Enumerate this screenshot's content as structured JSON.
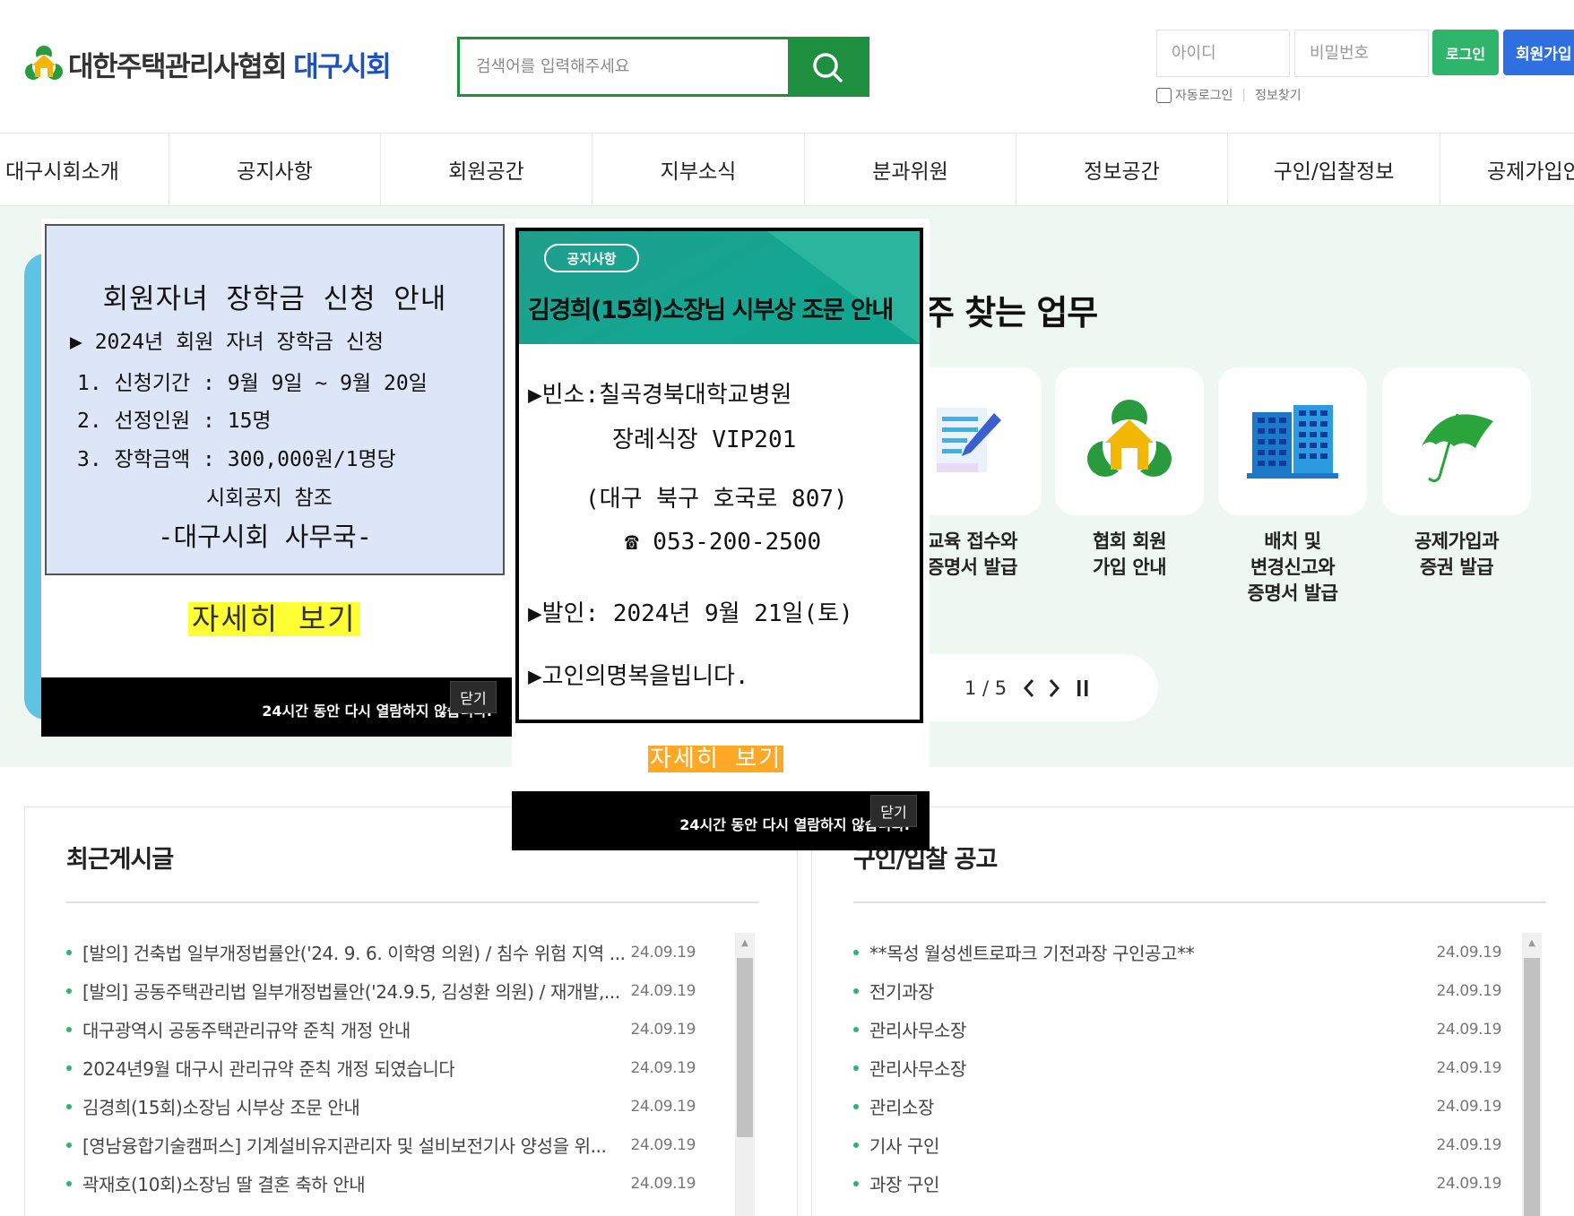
{
  "header": {
    "logo_text": "대한주택관리사협회",
    "logo_sub": "대구시회",
    "search_placeholder": "검색어를 입력해주세요",
    "id_placeholder": "아이디",
    "pw_placeholder": "비밀번호",
    "login_label": "로그인",
    "join_label": "회원가입",
    "auto_login_label": "자동로그인",
    "find_info_label": "정보찾기"
  },
  "nav": {
    "items": [
      {
        "label": "대구시회소개"
      },
      {
        "label": "공지사항"
      },
      {
        "label": "회원공간"
      },
      {
        "label": "지부소식"
      },
      {
        "label": "분과위원"
      },
      {
        "label": "정보공간"
      },
      {
        "label": "구인/입찰정보"
      },
      {
        "label": "공제가입안"
      }
    ]
  },
  "hero": {
    "title": "자주 찾는 업무",
    "title_visible": "주 찾는 업무",
    "cards": [
      {
        "icon": "document-pen-icon",
        "label_l1": "교육 접수와",
        "label_l2": "증명서 발급",
        "label_l3": ""
      },
      {
        "icon": "association-logo-icon",
        "label_l1": "협회 회원",
        "label_l2": "가입 안내",
        "label_l3": ""
      },
      {
        "icon": "building-icon",
        "label_l1": "배치 및",
        "label_l2": "변경신고와",
        "label_l3": "증명서 발급"
      },
      {
        "icon": "umbrella-icon",
        "label_l1": "공제가입과",
        "label_l2": "증권 발급",
        "label_l3": ""
      }
    ],
    "cards_visible": [
      {
        "label_l1": "교육 접수와",
        "label_l2": "증명서 발급"
      }
    ],
    "pager": "1 / 5"
  },
  "popup1": {
    "title": "회원자녀 장학금 신청 안내",
    "line1": "▶ 2024년 회원 자녀 장학금 신청",
    "line2": "1. 신청기간 : 9월 9일 ~ 9월 20일",
    "line3": "2. 선정인원 : 15명",
    "line4": "3. 장학금액 : 300,000원/1명당",
    "line5": "시회공지 참조",
    "line6": "-대구시회 사무국-",
    "more": "자세히 보기",
    "hide_msg": "24시간 동안 다시 열람하지 않습니다.",
    "close": "닫기"
  },
  "popup2": {
    "badge": "공지사항",
    "title": "김경희(15회)소장님 시부상 조문 안내",
    "line1": "▶빈소:칠곡경북대학교병원",
    "line2": "장례식장 VIP201",
    "line3": "(대구 북구 호국로 807)",
    "line4": "☎ 053-200-2500",
    "line5": "▶발인: 2024년 9월 21일(토)",
    "line6": "▶고인의명복을빕니다.",
    "more": "자세히 보기",
    "hide_msg": "24시간 동안 다시 열람하지 않습니다.",
    "close": "닫기"
  },
  "recent": {
    "title": "최근게시글",
    "items": [
      {
        "title": "[발의] 건축법 일부개정법률안('24. 9. 6. 이학영 의원) / 침수 위험 지역 ...",
        "date": "24.09.19"
      },
      {
        "title": "[발의] 공동주택관리법 일부개정법률안('24.9.5, 김성환 의원) / 재개발,...",
        "date": "24.09.19"
      },
      {
        "title": "대구광역시 공동주택관리규약 준칙 개정 안내",
        "date": "24.09.19"
      },
      {
        "title": "2024년9월 대구시 관리규약 준칙 개정 되였습니다",
        "date": "24.09.19"
      },
      {
        "title": "김경희(15회)소장님 시부상 조문 안내",
        "date": "24.09.19"
      },
      {
        "title": "[영남융합기술캠퍼스] 기계설비유지관리자 및 설비보전기사 양성을 위...",
        "date": "24.09.19"
      },
      {
        "title": "곽재호(10회)소장님 딸 결혼 축하 안내",
        "date": "24.09.19"
      }
    ]
  },
  "jobs": {
    "title": "구인/입찰 공고",
    "items": [
      {
        "title": "**목성 월성센트로파크 기전과장 구인공고**",
        "date": "24.09.19"
      },
      {
        "title": "전기과장",
        "date": "24.09.19"
      },
      {
        "title": "관리사무소장",
        "date": "24.09.19"
      },
      {
        "title": "관리사무소장",
        "date": "24.09.19"
      },
      {
        "title": "관리소장",
        "date": "24.09.19"
      },
      {
        "title": "기사 구인",
        "date": "24.09.19"
      },
      {
        "title": "과장 구인",
        "date": "24.09.19"
      }
    ]
  },
  "colors": {
    "brand_green": "#1e8f3e",
    "login_green": "#2eb56b",
    "join_blue": "#2f6fe2",
    "hero_bg": "#eef7f2",
    "popup2_teal": "#14a692"
  }
}
